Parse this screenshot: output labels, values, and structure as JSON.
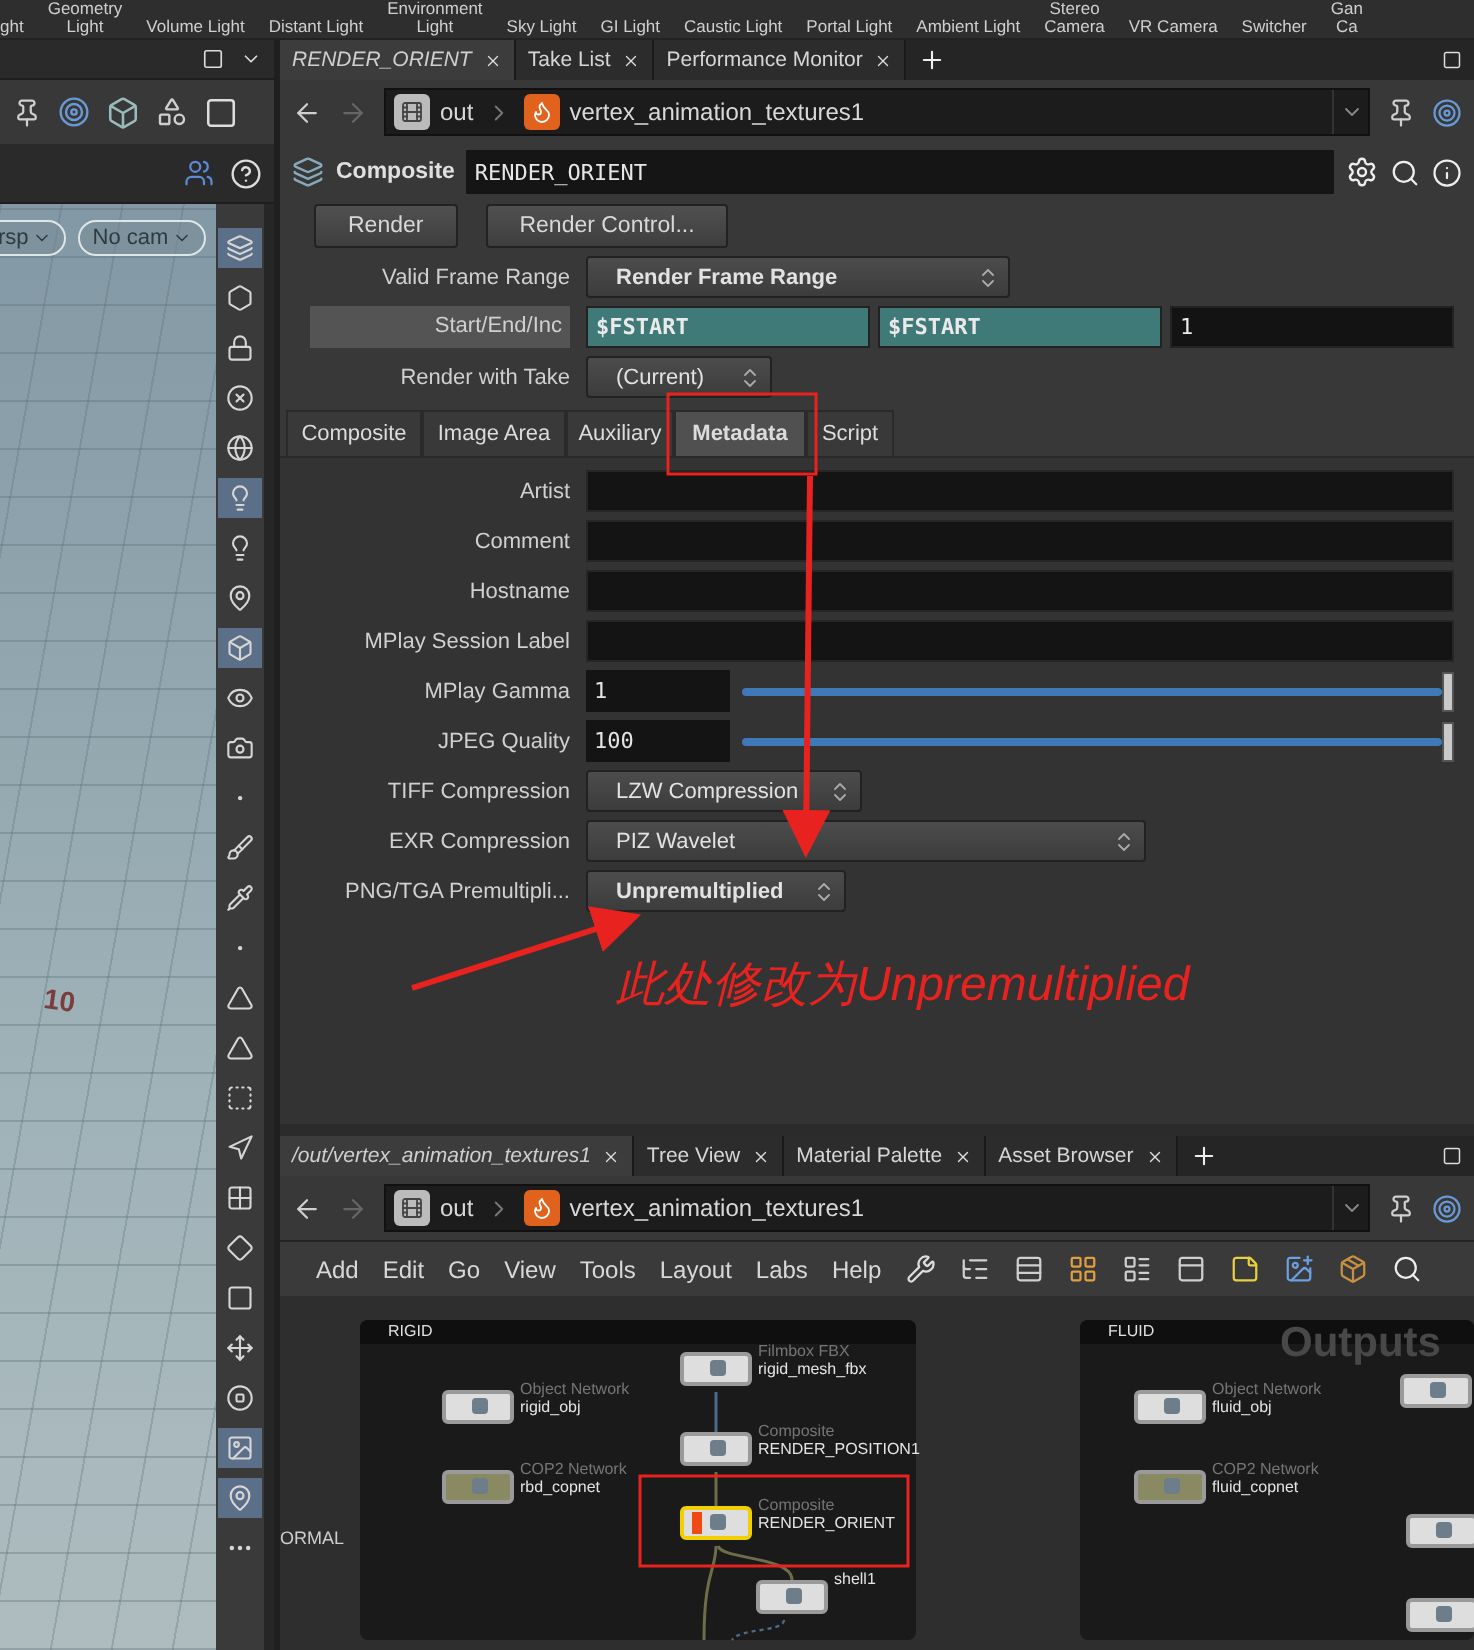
{
  "shelf": {
    "tools": [
      {
        "lines": [
          "ght"
        ]
      },
      {
        "lines": [
          "Geometry",
          "Light"
        ]
      },
      {
        "lines": [
          "Volume Light"
        ]
      },
      {
        "lines": [
          "Distant Light"
        ]
      },
      {
        "lines": [
          "Environment",
          "Light"
        ]
      },
      {
        "lines": [
          "Sky Light"
        ]
      },
      {
        "lines": [
          "GI Light"
        ]
      },
      {
        "lines": [
          "Caustic Light"
        ]
      },
      {
        "lines": [
          "Portal Light"
        ]
      },
      {
        "lines": [
          "Ambient Light"
        ]
      },
      {
        "lines": [
          "Stereo",
          "Camera"
        ]
      },
      {
        "lines": [
          "VR Camera"
        ]
      },
      {
        "lines": [
          "Switcher"
        ]
      },
      {
        "lines": [
          "Gan",
          "Ca"
        ]
      }
    ]
  },
  "viewport": {
    "camera_menus": [
      "rsp",
      "No cam"
    ],
    "grid_label": "10",
    "toolbar": [
      {
        "selected": true
      },
      {
        "selected": false
      },
      {
        "selected": false
      },
      {
        "selected": false
      },
      {
        "selected": false
      },
      {
        "selected": true
      },
      {
        "selected": false
      },
      {
        "selected": false
      },
      {
        "selected": true
      },
      {
        "selected": false
      },
      {
        "selected": false
      },
      {
        "selected": false
      },
      {
        "selected": false
      },
      {
        "selected": false
      },
      {
        "selected": false
      },
      {
        "selected": false
      },
      {
        "selected": false
      },
      {
        "selected": false
      },
      {
        "selected": false
      },
      {
        "selected": false
      },
      {
        "selected": false
      },
      {
        "selected": false
      },
      {
        "selected": false
      },
      {
        "selected": false
      },
      {
        "selected": true
      },
      {
        "selected": true
      },
      {
        "selected": false
      }
    ]
  },
  "parameters": {
    "tabs": [
      {
        "label": "RENDER_ORIENT",
        "selected": true
      },
      {
        "label": "Take List",
        "selected": false
      },
      {
        "label": "Performance Monitor",
        "selected": false
      }
    ],
    "path": [
      "out",
      "vertex_animation_textures1"
    ],
    "node_type": "Composite",
    "node_name": "RENDER_ORIENT",
    "buttons": [
      "Render",
      "Render Control..."
    ],
    "valid_frame_range": {
      "label": "Valid Frame Range",
      "value": "Render Frame Range",
      "changed": true
    },
    "start_end_inc": {
      "label": "Start/End/Inc",
      "values": [
        "$FSTART",
        "$FSTART",
        "1"
      ]
    },
    "render_with_take": {
      "label": "Render with Take",
      "value": "(Current)",
      "changed": false
    },
    "section_tabs": [
      {
        "label": "Composite",
        "selected": false
      },
      {
        "label": "Image Area",
        "selected": false
      },
      {
        "label": "Auxiliary",
        "selected": false
      },
      {
        "label": "Metadata",
        "selected": true
      },
      {
        "label": "Script",
        "selected": false
      }
    ],
    "fields": [
      {
        "kind": "text",
        "label": "Artist"
      },
      {
        "kind": "text",
        "label": "Comment"
      },
      {
        "kind": "text",
        "label": "Hostname"
      },
      {
        "kind": "text",
        "label": "MPlay Session Label"
      },
      {
        "kind": "slider",
        "label": "MPlay Gamma",
        "value": "1",
        "level": 1
      },
      {
        "kind": "slider",
        "label": "JPEG Quality",
        "value": "100",
        "level": 1
      },
      {
        "kind": "menu",
        "label": "TIFF Compression",
        "value": "LZW Compression",
        "changed": false
      },
      {
        "kind": "menu",
        "label": "EXR Compression",
        "value": "PIZ Wavelet",
        "changed": false
      },
      {
        "kind": "menu",
        "label": "PNG/TGA Premultipli...",
        "value": "Unpremultiplied",
        "changed": true
      }
    ]
  },
  "network": {
    "tabs": [
      {
        "label": "/out/vertex_animation_textures1",
        "selected": true
      },
      {
        "label": "Tree View",
        "selected": false
      },
      {
        "label": "Material Palette",
        "selected": false
      },
      {
        "label": "Asset Browser",
        "selected": false
      }
    ],
    "path": [
      "out",
      "vertex_animation_textures1"
    ],
    "menu": [
      "Add",
      "Edit",
      "Go",
      "View",
      "Tools",
      "Layout",
      "Labs",
      "Help"
    ],
    "side_label": "ORMAL",
    "boxes": [
      {
        "title": "RIGID",
        "nodes": [
          {
            "type": "Object Network",
            "name": "rigid_obj",
            "color": "#dedede",
            "selected": false,
            "flagged": false
          },
          {
            "type": "COP2 Network",
            "name": "rbd_copnet",
            "color": "#8a8a62",
            "selected": false,
            "flagged": false
          },
          {
            "type": "Filmbox FBX",
            "name": "rigid_mesh_fbx",
            "color": "#dedede",
            "selected": false,
            "flagged": false
          },
          {
            "type": "Composite",
            "name": "RENDER_POSITION1",
            "color": "#dedede",
            "selected": false,
            "flagged": false
          },
          {
            "type": "Composite",
            "name": "RENDER_ORIENT",
            "color": "#dedede",
            "selected": true,
            "flagged": true
          },
          {
            "name": "shell1",
            "color": "#dedede",
            "selected": false,
            "flagged": false
          }
        ]
      },
      {
        "title": "FLUID",
        "sticky": "Outputs",
        "nodes": [
          {
            "type": "Object Network",
            "name": "fluid_obj",
            "color": "#dedede",
            "selected": false,
            "flagged": false
          },
          {
            "type": "COP2 Network",
            "name": "fluid_copnet",
            "color": "#8a8a62",
            "selected": false,
            "flagged": false
          },
          {
            "color": "#dedede",
            "selected": false,
            "flagged": false
          },
          {
            "color": "#dedede",
            "selected": false,
            "flagged": false
          },
          {
            "color": "#dedede",
            "selected": false,
            "flagged": false
          }
        ]
      }
    ]
  },
  "annotation": {
    "text": "此处修改为Unpremultiplied"
  }
}
